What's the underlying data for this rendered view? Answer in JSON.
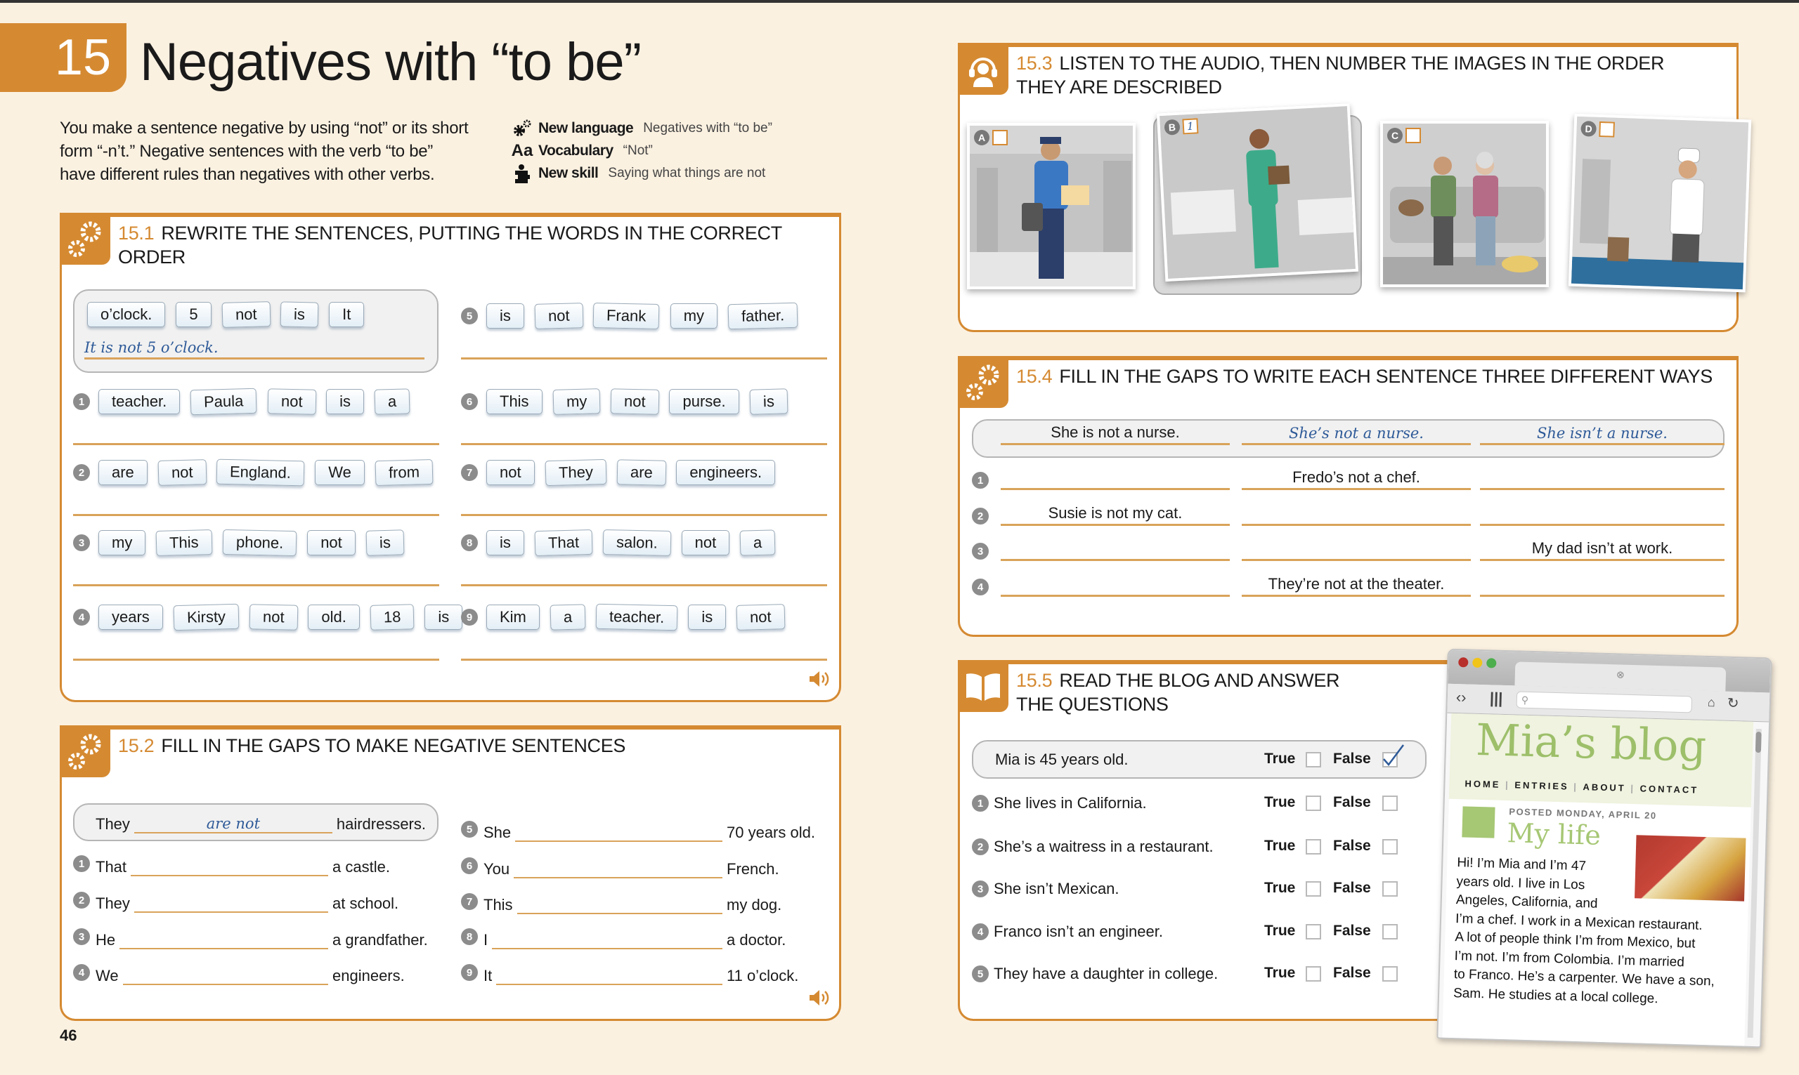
{
  "chapter": {
    "number": "15",
    "title": "Negatives with “to be”"
  },
  "intro": [
    "You make a sentence negative by using “not” or its short",
    "form “-n’t.” Negative sentences with the verb “to be”",
    "have different rules than negatives with other verbs."
  ],
  "info": [
    {
      "icon": "gears-icon",
      "label": "New language",
      "value": "Negatives with “to be”"
    },
    {
      "icon": "aa-icon",
      "label": "Vocabulary",
      "value": "“Not”"
    },
    {
      "icon": "puzzle-icon",
      "label": "New skill",
      "value": "Saying what things are not"
    }
  ],
  "ex151": {
    "number": "15.1",
    "title": "REWRITE THE SENTENCES, PUTTING THE WORDS IN THE CORRECT ORDER",
    "example": {
      "tiles": [
        "o’clock.",
        "5",
        "not",
        "is",
        "It"
      ],
      "answer": "It is not 5 o’clock."
    },
    "items": [
      {
        "n": "1",
        "tiles": [
          "teacher.",
          "Paula",
          "not",
          "is",
          "a"
        ]
      },
      {
        "n": "2",
        "tiles": [
          "are",
          "not",
          "England.",
          "We",
          "from"
        ]
      },
      {
        "n": "3",
        "tiles": [
          "my",
          "This",
          "phone.",
          "not",
          "is"
        ]
      },
      {
        "n": "4",
        "tiles": [
          "years",
          "Kirsty",
          "not",
          "old.",
          "18",
          "is"
        ]
      },
      {
        "n": "5",
        "tiles": [
          "is",
          "not",
          "Frank",
          "my",
          "father."
        ]
      },
      {
        "n": "6",
        "tiles": [
          "This",
          "my",
          "not",
          "purse.",
          "is"
        ]
      },
      {
        "n": "7",
        "tiles": [
          "not",
          "They",
          "are",
          "engineers."
        ]
      },
      {
        "n": "8",
        "tiles": [
          "is",
          "That",
          "salon.",
          "not",
          "a"
        ]
      },
      {
        "n": "9",
        "tiles": [
          "Kim",
          "a",
          "teacher.",
          "is",
          "not"
        ]
      }
    ]
  },
  "ex152": {
    "number": "15.2",
    "title": "FILL IN THE GAPS TO MAKE NEGATIVE SENTENCES",
    "example": {
      "prefix": "They",
      "answer": "are not",
      "suffix": "hairdressers."
    },
    "items": [
      {
        "n": "1",
        "prefix": "That",
        "suffix": "a castle."
      },
      {
        "n": "2",
        "prefix": "They",
        "suffix": "at school."
      },
      {
        "n": "3",
        "prefix": "He",
        "suffix": "a grandfather."
      },
      {
        "n": "4",
        "prefix": "We",
        "suffix": "engineers."
      },
      {
        "n": "5",
        "prefix": "She",
        "suffix": "70 years old."
      },
      {
        "n": "6",
        "prefix": "You",
        "suffix": "French."
      },
      {
        "n": "7",
        "prefix": "This",
        "suffix": "my dog."
      },
      {
        "n": "8",
        "prefix": "I",
        "suffix": "a doctor."
      },
      {
        "n": "9",
        "prefix": "It",
        "suffix": "11 o’clock."
      }
    ]
  },
  "ex153": {
    "number": "15.3",
    "title_lines": [
      "LISTEN TO THE AUDIO, THEN NUMBER THE IMAGES IN THE ORDER",
      "THEY ARE DESCRIBED"
    ],
    "images": [
      {
        "letter": "A",
        "answer": ""
      },
      {
        "letter": "B",
        "answer": "1"
      },
      {
        "letter": "C",
        "answer": ""
      },
      {
        "letter": "D",
        "answer": ""
      }
    ]
  },
  "ex154": {
    "number": "15.4",
    "title": "FILL IN THE GAPS TO WRITE EACH SENTENCE THREE DIFFERENT WAYS",
    "example": [
      "She is not a nurse.",
      "She’s not a nurse.",
      "She isn’t a nurse."
    ],
    "items": [
      {
        "n": "1",
        "cells": [
          "",
          "Fredo’s not a chef.",
          ""
        ]
      },
      {
        "n": "2",
        "cells": [
          "Susie is not my cat.",
          "",
          ""
        ]
      },
      {
        "n": "3",
        "cells": [
          "",
          "",
          "My dad isn’t at work."
        ]
      },
      {
        "n": "4",
        "cells": [
          "",
          "They’re not at the theater.",
          ""
        ]
      }
    ]
  },
  "ex155": {
    "number": "15.5",
    "title_lines": [
      "READ THE BLOG AND ANSWER",
      "THE QUESTIONS"
    ],
    "true_label": "True",
    "false_label": "False",
    "example": {
      "text": "Mia is 45 years old.",
      "answer": "false"
    },
    "items": [
      {
        "n": "1",
        "text": "She lives in California."
      },
      {
        "n": "2",
        "text": "She’s a waitress in a restaurant."
      },
      {
        "n": "3",
        "text": "She isn’t Mexican."
      },
      {
        "n": "4",
        "text": "Franco isn’t an engineer."
      },
      {
        "n": "5",
        "text": "They have a daughter in college."
      }
    ]
  },
  "blog": {
    "title": "Mia’s blog",
    "nav": [
      "HOME",
      "ENTRIES",
      "ABOUT",
      "CONTACT"
    ],
    "posted": "POSTED MONDAY, APRIL 20",
    "post_title": "My life",
    "body_lines": [
      "Hi! I’m Mia and I’m 47",
      "years old. I live in Los",
      "Angeles, California, and",
      "I’m a chef. I work in a Mexican restaurant.",
      "A lot of people think I’m from Mexico, but",
      "I’m not. I’m from Colombia. I’m married",
      "to Franco. He’s a carpenter. We have a son,",
      "Sam. He studies at a local college."
    ]
  },
  "page_number": "46",
  "colors": {
    "accent": "#d58a32",
    "background": "#fbf1e1",
    "handwriting": "#2e5a98",
    "blog_green": "#9dbf6a",
    "tile_border": "#9aaab8"
  }
}
